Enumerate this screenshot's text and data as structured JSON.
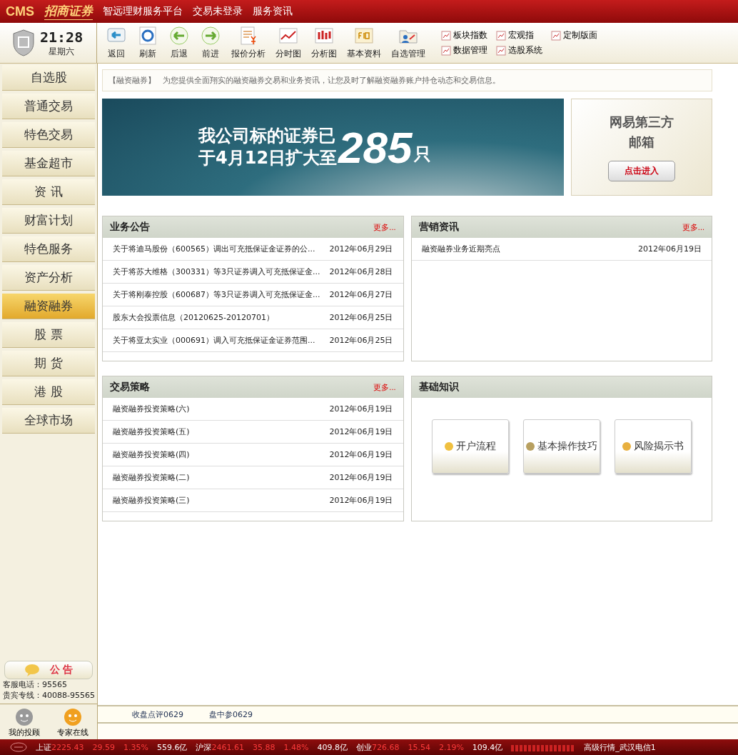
{
  "title_bar": {
    "logo": "CMS",
    "brand": "招商证券",
    "menu": [
      "智远理财服务平台",
      "交易未登录",
      "服务资讯"
    ]
  },
  "clock": {
    "time": "21:28",
    "weekday": "星期六"
  },
  "toolbar": {
    "buttons": [
      "返回",
      "刷新",
      "后退",
      "前进",
      "报价分析",
      "分时图",
      "分析图",
      "基本资料",
      "自选管理"
    ],
    "small_buttons": [
      "板块指数",
      "宏观指",
      "定制版面",
      "数据管理",
      "选股系统"
    ]
  },
  "sidebar": {
    "items": [
      {
        "label": "自选股",
        "selected": false
      },
      {
        "label": "普通交易",
        "selected": false
      },
      {
        "label": "特色交易",
        "selected": false
      },
      {
        "label": "基金超市",
        "selected": false
      },
      {
        "label": "资 讯",
        "selected": false
      },
      {
        "label": "财富计划",
        "selected": false
      },
      {
        "label": "特色服务",
        "selected": false
      },
      {
        "label": "资产分析",
        "selected": false
      },
      {
        "label": "融资融券",
        "selected": true
      },
      {
        "label": "股 票",
        "selected": false
      },
      {
        "label": "期 货",
        "selected": false
      },
      {
        "label": "港 股",
        "selected": false
      },
      {
        "label": "全球市场",
        "selected": false
      }
    ],
    "notice_button": "公 告",
    "hotline": "客服电话：95565",
    "vip_line": "贵宾专线：40088-95565",
    "assistants": [
      "我的投顾",
      "专家在线"
    ]
  },
  "intro": {
    "tag": "【融资融券】",
    "text": "为您提供全面翔实的融资融券交易和业务资讯，让您及时了解融资融券账户持仓动态和交易信息。"
  },
  "banner": {
    "line1": "我公司标的证券已",
    "line2": "于4月12日扩大至",
    "number": "285",
    "unit": "只"
  },
  "mail_card": {
    "title": "网易第三方",
    "subtitle": "邮箱",
    "button": "点击进入"
  },
  "panels": [
    {
      "title": "业务公告",
      "more": "更多...",
      "rows": [
        {
          "text": "关于将迪马股份（600565）调出可充抵保证金证券的公...",
          "date": "2012年06月29日"
        },
        {
          "text": "关于将苏大维格（300331）等3只证券调入可充抵保证金...",
          "date": "2012年06月28日"
        },
        {
          "text": "关于将刚泰控股（600687）等3只证券调入可充抵保证金...",
          "date": "2012年06月27日"
        },
        {
          "text": "股东大会投票信息（20120625-20120701）",
          "date": "2012年06月25日"
        },
        {
          "text": "关于将亚太实业（000691）调入可充抵保证金证券范围...",
          "date": "2012年06月25日"
        }
      ]
    },
    {
      "title": "营销资讯",
      "more": "更多...",
      "rows": [
        {
          "text": "融资融券业务近期亮点",
          "date": "2012年06月19日"
        }
      ]
    },
    {
      "title": "交易策略",
      "more": "更多...",
      "rows": [
        {
          "text": "融资融券投资策略(六)",
          "date": "2012年06月19日"
        },
        {
          "text": "融资融券投资策略(五)",
          "date": "2012年06月19日"
        },
        {
          "text": "融资融券投资策略(四)",
          "date": "2012年06月19日"
        },
        {
          "text": "融资融券投资策略(二)",
          "date": "2012年06月19日"
        },
        {
          "text": "融资融券投资策略(三)",
          "date": "2012年06月19日"
        }
      ]
    },
    {
      "title": "基础知识",
      "buttons": [
        "开户流程",
        "基本操作技巧",
        "风险揭示书"
      ]
    }
  ],
  "bottom_links": [
    "收盘点评0629",
    "盘中参0629"
  ],
  "ticker": {
    "indices": [
      {
        "name": "上证",
        "value": "2225.43",
        "change": "29.59",
        "percent": "1.35%",
        "volume": "559.6亿"
      },
      {
        "name": "沪深",
        "value": "2461.61",
        "change": "35.88",
        "percent": "1.48%",
        "volume": "409.8亿"
      },
      {
        "name": "创业",
        "value": "726.68",
        "change": "15.54",
        "percent": "2.19%",
        "volume": "109.4亿"
      }
    ],
    "server": "高级行情_武汉电信1"
  }
}
